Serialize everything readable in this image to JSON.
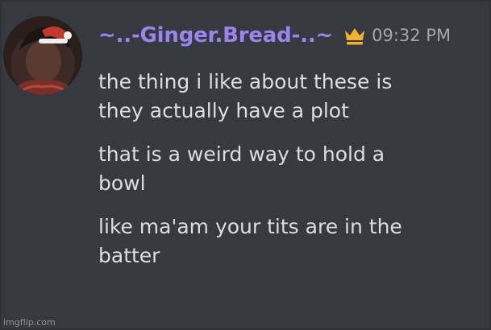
{
  "message_group": {
    "username": "~..-Ginger.Bread-..~",
    "timestamp": "09:32 PM",
    "badge_icon": "crown-icon",
    "username_color": "#9b84ee",
    "badge_color": "#f0b132",
    "messages": [
      {
        "lines": [
          "the thing i like about these is",
          "they actually have a plot"
        ]
      },
      {
        "lines": [
          "that is a weird way to hold a",
          "bowl"
        ]
      },
      {
        "lines": [
          "like ma'am your tits are in the",
          "batter"
        ]
      }
    ]
  },
  "watermark": "imgflip.com"
}
